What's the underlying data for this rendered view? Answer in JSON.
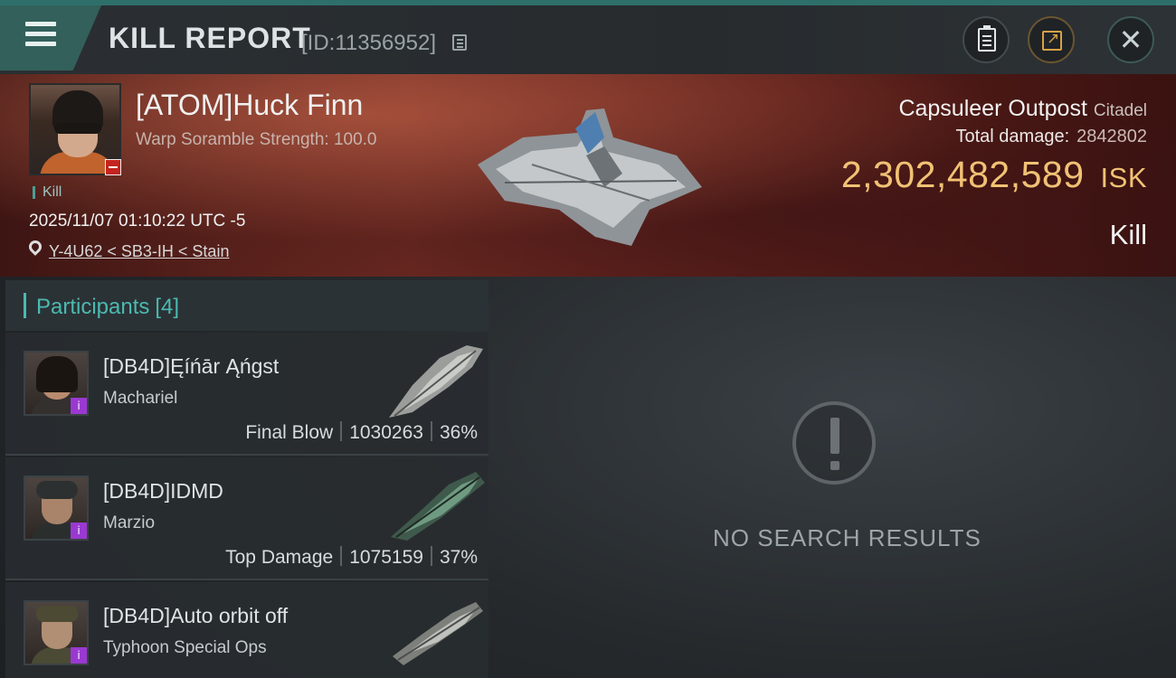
{
  "header": {
    "title": "KILL REPORT",
    "kill_id": "[ID:11356952]"
  },
  "victim": {
    "name": "[ATOM]Huck Finn",
    "stat": "Warp Soramble Strength: 100.0",
    "kill_tag": "Kill",
    "timestamp": "2025/11/07 01:10:22 UTC -5",
    "location": "Y-4U62 < SB3-IH < Stain"
  },
  "target": {
    "name": "Capsuleer Outpost",
    "class": "Citadel",
    "damage_label": "Total damage:",
    "damage_value": "2842802",
    "isk_value": "2,302,482,589",
    "isk_unit": "ISK",
    "result": "Kill"
  },
  "participants": {
    "label": "Participants",
    "count": "[4]",
    "items": [
      {
        "name": "[DB4D]Ęíńār Ąńgst",
        "ship": "Machariel",
        "role": "Final Blow",
        "damage": "1030263",
        "pct": "36%",
        "ship_icon": "battleship-machariel-icon"
      },
      {
        "name": "[DB4D]IDMD",
        "ship": "Marzio",
        "role": "Top Damage",
        "damage": "1075159",
        "pct": "37%",
        "ship_icon": "battleship-marzio-icon"
      },
      {
        "name": "[DB4D]Auto orbit off",
        "ship": "Typhoon Special Ops",
        "role": "",
        "damage": "",
        "pct": "",
        "ship_icon": "battleship-typhoon-icon"
      }
    ]
  },
  "empty_state": {
    "text": "NO SEARCH RESULTS"
  },
  "colors": {
    "accent_teal": "#4bbab0",
    "isk_gold": "#f1c274",
    "badge_purple": "#9a39d1",
    "badge_red": "#c4241f"
  }
}
